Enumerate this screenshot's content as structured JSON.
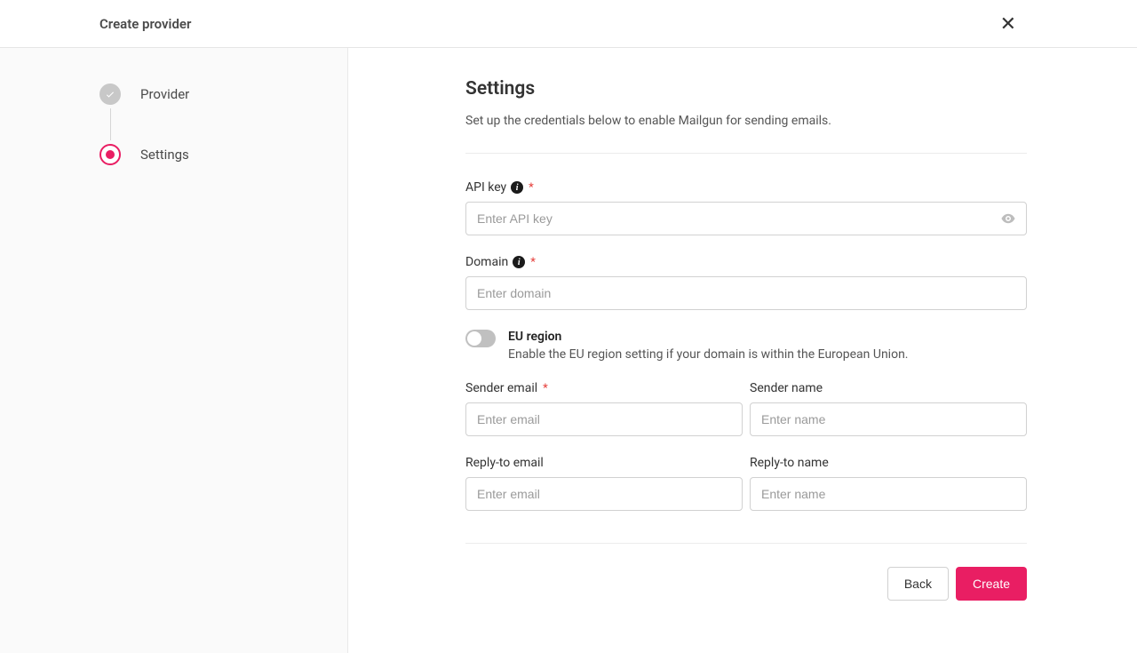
{
  "header": {
    "title": "Create provider"
  },
  "sidebar": {
    "steps": [
      {
        "label": "Provider",
        "state": "done"
      },
      {
        "label": "Settings",
        "state": "active"
      }
    ]
  },
  "main": {
    "title": "Settings",
    "description": "Set up the credentials below to enable Mailgun for sending emails.",
    "fields": {
      "api_key": {
        "label": "API key",
        "placeholder": "Enter API key",
        "value": ""
      },
      "domain": {
        "label": "Domain",
        "placeholder": "Enter domain",
        "value": ""
      },
      "eu_region": {
        "label": "EU region",
        "description": "Enable the EU region setting if your domain is within the European Union.",
        "enabled": false
      },
      "sender_email": {
        "label": "Sender email",
        "placeholder": "Enter email",
        "value": ""
      },
      "sender_name": {
        "label": "Sender name",
        "placeholder": "Enter name",
        "value": ""
      },
      "reply_to_email": {
        "label": "Reply-to email",
        "placeholder": "Enter email",
        "value": ""
      },
      "reply_to_name": {
        "label": "Reply-to name",
        "placeholder": "Enter name",
        "value": ""
      }
    }
  },
  "footer": {
    "back_label": "Back",
    "create_label": "Create"
  }
}
